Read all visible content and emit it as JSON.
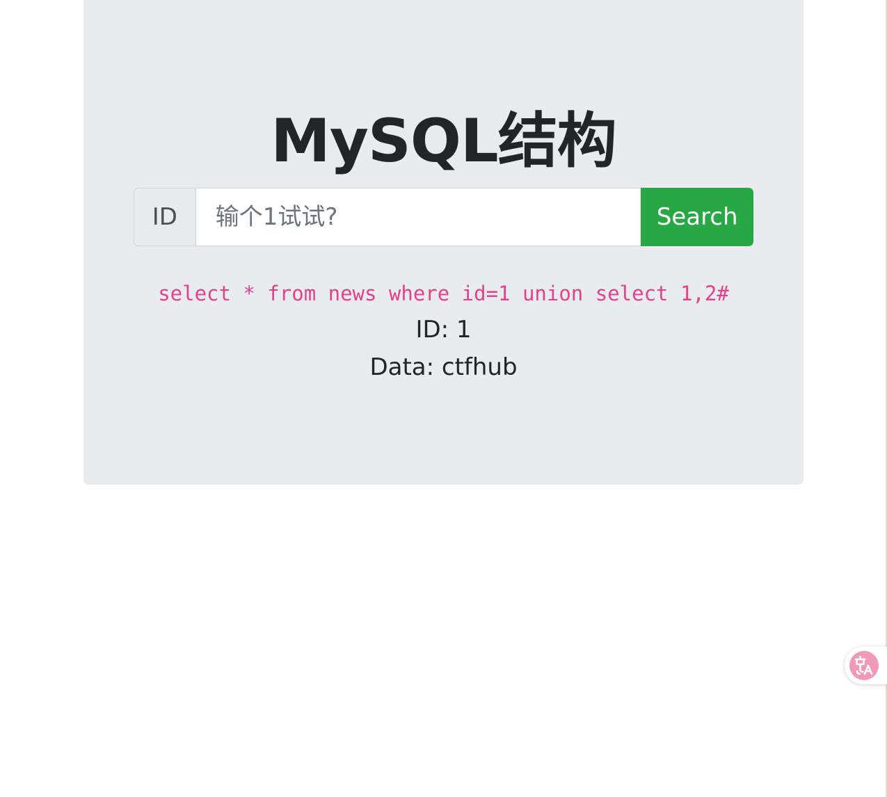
{
  "title": "MySQL结构",
  "search": {
    "addon_label": "ID",
    "placeholder": "输个1试试?",
    "button_label": "Search"
  },
  "result": {
    "query": "select * from news where id=1 union select 1,2#",
    "id_line": "ID: 1",
    "data_line": "Data: ctfhub"
  },
  "widgets": {
    "translate_icon": "translate-icon"
  },
  "colors": {
    "jumbotron_bg": "#e9ecef",
    "button_green": "#28a745",
    "sql_pink": "#e83e8c",
    "translate_pink": "#f199b6"
  }
}
